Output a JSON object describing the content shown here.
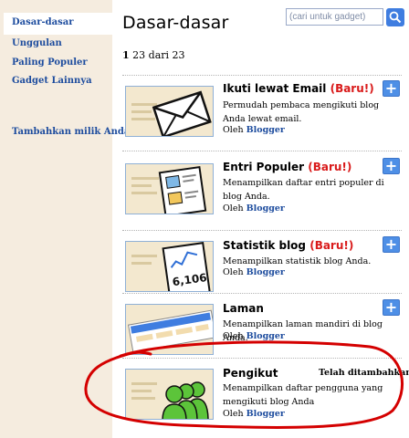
{
  "sidebar": {
    "items": [
      {
        "label": "Dasar-dasar"
      },
      {
        "label": "Unggulan"
      },
      {
        "label": "Paling Populer"
      },
      {
        "label": "Gadget Lainnya"
      },
      {
        "label": "Tambahkan milik Anda"
      }
    ]
  },
  "header": {
    "title": "Dasar-dasar",
    "search_placeholder": "(cari untuk gadget)",
    "search_icon": "search-icon"
  },
  "paging": {
    "current": "1",
    "rest": "23 dari 23"
  },
  "gadgets": [
    {
      "name": "Ikuti lewat Email",
      "badge": "(Baru!)",
      "desc": "Permudah pembaca mengikuti blog Anda lewat email.",
      "by_label": "Oleh",
      "by": "Blogger",
      "icon": "envelope-icon"
    },
    {
      "name": "Entri Populer",
      "badge": "(Baru!)",
      "desc": "Menampilkan daftar entri populer di blog Anda.",
      "by_label": "Oleh",
      "by": "Blogger",
      "icon": "document-icon"
    },
    {
      "name": "Statistik blog",
      "badge": "(Baru!)",
      "desc": "Menampilkan statistik blog Anda.",
      "by_label": "Oleh",
      "by": "Blogger",
      "icon": "stats-chart-icon",
      "stat": "6,106"
    },
    {
      "name": "Laman",
      "badge": "",
      "desc": "Menampilkan laman mandiri di blog Anda.",
      "by_label": "Oleh",
      "by": "Blogger",
      "icon": "pages-icon"
    },
    {
      "name": "Pengikut",
      "badge": "",
      "desc": "Menampilkan daftar pengguna yang mengikuti blog Anda",
      "by_label": "Oleh",
      "by": "Blogger",
      "icon": "followers-icon",
      "status": "Telah ditambahkan"
    }
  ],
  "colors": {
    "link": "#1d4c9e",
    "new_badge": "#d91a1a",
    "add_button": "#4e8fe6",
    "highlight_circle": "#d40000",
    "sidebar_bg": "#f5ecdf"
  }
}
